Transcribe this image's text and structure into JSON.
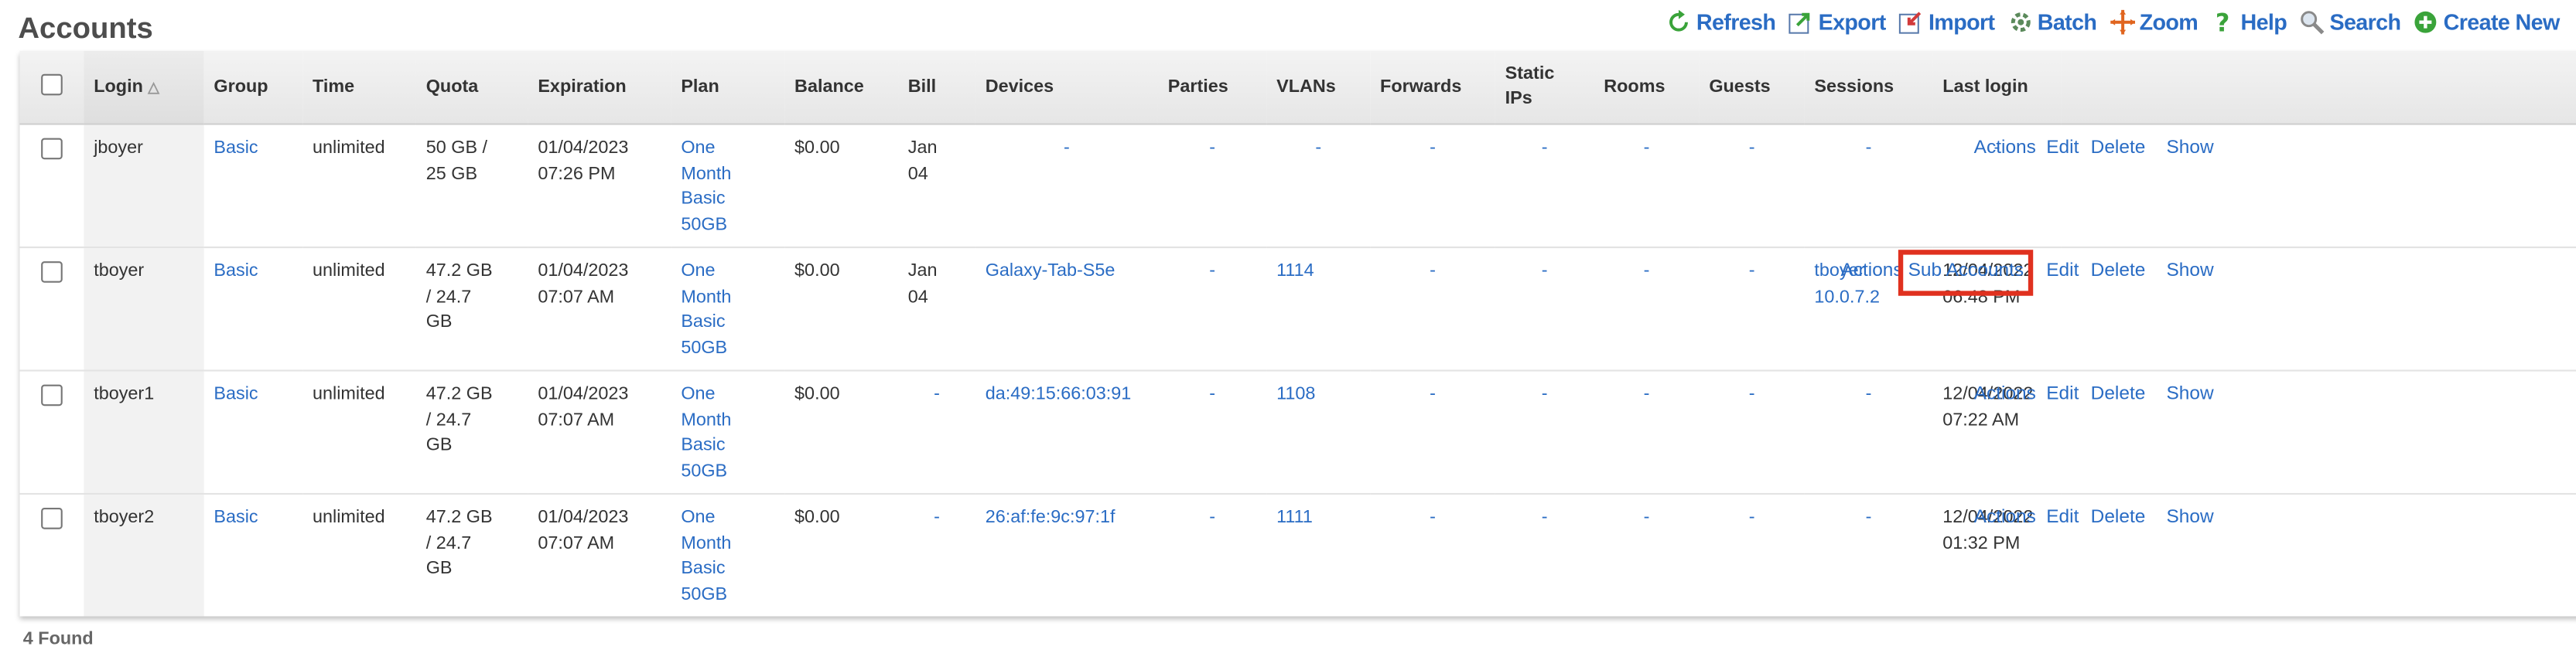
{
  "page": {
    "title": "Accounts",
    "found": "4 Found"
  },
  "toolbar": [
    {
      "label": "Refresh",
      "icon": "refresh-icon",
      "color": "#3aa33a"
    },
    {
      "label": "Export",
      "icon": "export-icon",
      "color": "#3aa33a"
    },
    {
      "label": "Import",
      "icon": "import-icon",
      "color": "#d23a3a"
    },
    {
      "label": "Batch",
      "icon": "batch-icon",
      "color": "#5b8a5b"
    },
    {
      "label": "Zoom",
      "icon": "zoom-icon",
      "color": "#e0651f"
    },
    {
      "label": "Help",
      "icon": "help-icon",
      "color": "#3aa33a"
    },
    {
      "label": "Search",
      "icon": "search-icon",
      "color": "#8a8a8a"
    },
    {
      "label": "Create New",
      "icon": "create-new-icon",
      "color": "#3aa33a"
    }
  ],
  "columns": {
    "login": "Login",
    "group": "Group",
    "time": "Time",
    "quota": "Quota",
    "expiration": "Expiration",
    "plan": "Plan",
    "balance": "Balance",
    "bill": "Bill",
    "devices": "Devices",
    "parties": "Parties",
    "vlans": "VLANs",
    "forwards": "Forwards",
    "static_ips_1": "Static",
    "static_ips_2": "IPs",
    "rooms": "Rooms",
    "guests": "Guests",
    "sessions": "Sessions",
    "last_login": "Last login"
  },
  "rows": [
    {
      "login": "jboyer",
      "group": "Basic",
      "time": "unlimited",
      "quota": [
        "50 GB /",
        "25 GB"
      ],
      "expiration": [
        "01/04/2023",
        "07:26 PM"
      ],
      "plan": [
        "One",
        "Month",
        "Basic",
        "50GB"
      ],
      "balance": "$0.00",
      "bill": [
        "Jan",
        "04"
      ],
      "devices": "-",
      "parties": "-",
      "vlans": "-",
      "forwards": "-",
      "static_ips": "-",
      "rooms": "-",
      "guests": "-",
      "sessions": [
        "-"
      ],
      "last_login": [
        "-"
      ],
      "actions": {
        "actions": "Actions",
        "sub": "",
        "edit": "Edit",
        "delete": "Delete",
        "show": "Show"
      }
    },
    {
      "login": "tboyer",
      "group": "Basic",
      "time": "unlimited",
      "quota": [
        "47.2 GB",
        "/ 24.7",
        "GB"
      ],
      "expiration": [
        "01/04/2023",
        "07:07 AM"
      ],
      "plan": [
        "One",
        "Month",
        "Basic",
        "50GB"
      ],
      "balance": "$0.00",
      "bill": [
        "Jan",
        "04"
      ],
      "devices": "Galaxy-Tab-S5e",
      "parties": "-",
      "vlans": "1114",
      "forwards": "-",
      "static_ips": "-",
      "rooms": "-",
      "guests": "-",
      "sessions": [
        "tboyer",
        "10.0.7.2"
      ],
      "last_login": [
        "12/04/2022",
        "06:48 PM"
      ],
      "actions": {
        "actions": "Actions",
        "sub": "Sub Accounts",
        "edit": "Edit",
        "delete": "Delete",
        "show": "Show"
      }
    },
    {
      "login": "tboyer1",
      "group": "Basic",
      "time": "unlimited",
      "quota": [
        "47.2 GB",
        "/ 24.7",
        "GB"
      ],
      "expiration": [
        "01/04/2023",
        "07:07 AM"
      ],
      "plan": [
        "One",
        "Month",
        "Basic",
        "50GB"
      ],
      "balance": "$0.00",
      "bill": [
        "-"
      ],
      "devices": "da:49:15:66:03:91",
      "parties": "-",
      "vlans": "1108",
      "forwards": "-",
      "static_ips": "-",
      "rooms": "-",
      "guests": "-",
      "sessions": [
        "-"
      ],
      "last_login": [
        "12/04/2022",
        "07:22 AM"
      ],
      "actions": {
        "actions": "Actions",
        "sub": "",
        "edit": "Edit",
        "delete": "Delete",
        "show": "Show"
      }
    },
    {
      "login": "tboyer2",
      "group": "Basic",
      "time": "unlimited",
      "quota": [
        "47.2 GB",
        "/ 24.7",
        "GB"
      ],
      "expiration": [
        "01/04/2023",
        "07:07 AM"
      ],
      "plan": [
        "One",
        "Month",
        "Basic",
        "50GB"
      ],
      "balance": "$0.00",
      "bill": [
        "-"
      ],
      "devices": "26:af:fe:9c:97:1f",
      "parties": "-",
      "vlans": "1111",
      "forwards": "-",
      "static_ips": "-",
      "rooms": "-",
      "guests": "-",
      "sessions": [
        "-"
      ],
      "last_login": [
        "12/04/2022",
        "01:32 PM"
      ],
      "actions": {
        "actions": "Actions",
        "sub": "",
        "edit": "Edit",
        "delete": "Delete",
        "show": "Show"
      }
    }
  ],
  "highlight": {
    "color": "#e0311f",
    "target": "Sub Accounts"
  }
}
